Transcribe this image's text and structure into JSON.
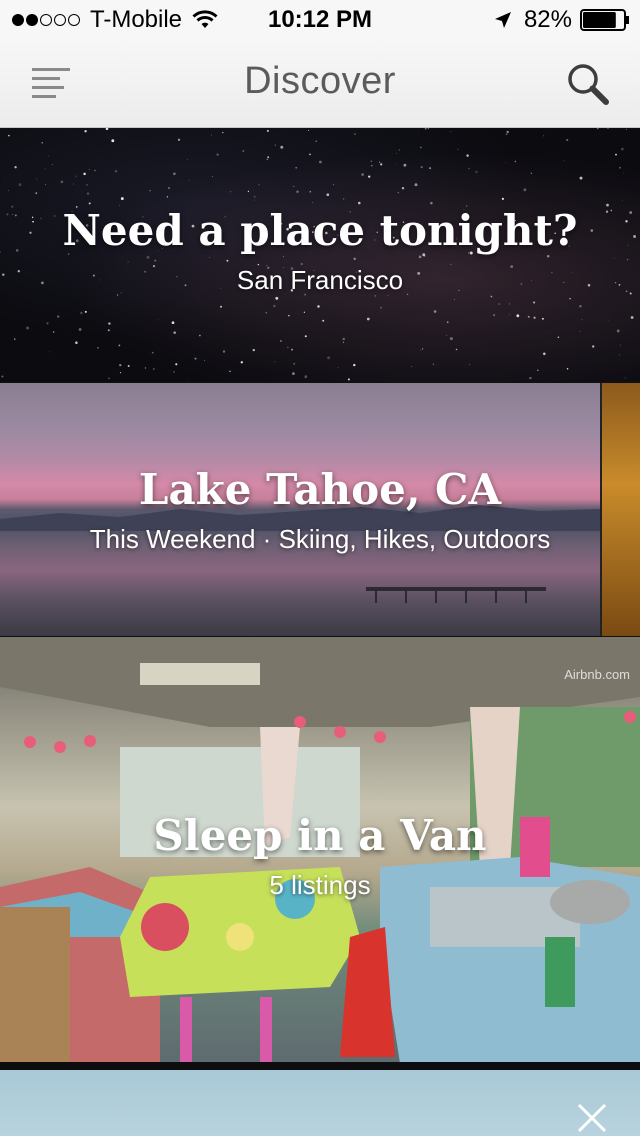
{
  "status_bar": {
    "carrier": "T-Mobile",
    "time": "10:12 PM",
    "battery": "82%",
    "signal_bars_filled": 2,
    "signal_bars_total": 5,
    "battery_level": 0.82
  },
  "nav": {
    "title": "Discover",
    "menu_icon": "hamburger-icon",
    "search_icon": "search-icon"
  },
  "cards": [
    {
      "title": "Need a place tonight?",
      "subtitle": "San Francisco"
    },
    {
      "title": "Lake Tahoe, CA",
      "subtitle": "This Weekend · Skiing, Hikes, Outdoors"
    },
    {
      "title": "Sleep in a Van",
      "subtitle": "5 listings",
      "watermark": "Airbnb.com"
    }
  ],
  "next_card": {
    "close_icon": "close-icon"
  }
}
